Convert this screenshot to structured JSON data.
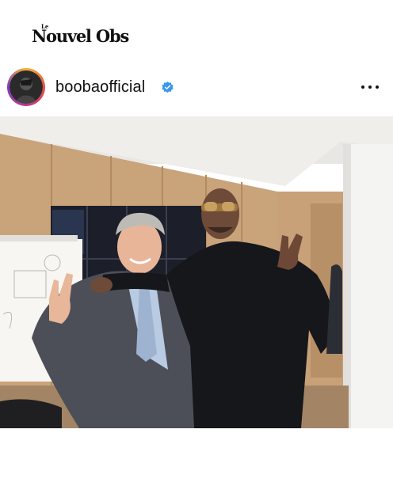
{
  "publisher": {
    "logo_text": "Nouvel Obs",
    "logo_small": "Le"
  },
  "post": {
    "username": "boobaofficial",
    "verified": true,
    "more_icon": "ellipsis-icon",
    "photo_alt": ""
  },
  "colors": {
    "verified_blue": "#3897f0",
    "ring_gradient": [
      "#f7b42c",
      "#e94e3d",
      "#c1358f",
      "#7d39c4"
    ]
  }
}
